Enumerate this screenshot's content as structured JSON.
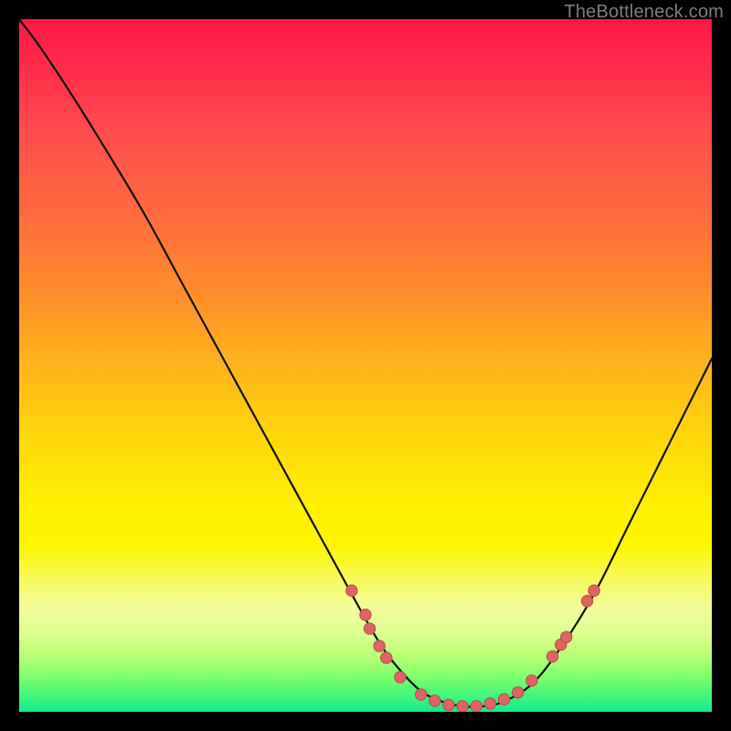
{
  "watermark": "TheBottleneck.com",
  "colors": {
    "background": "#000000",
    "curve_stroke": "#111111",
    "dot_fill": "#e06464",
    "dot_stroke": "#b94a4a",
    "watermark": "#7d7d7d"
  },
  "chart_data": {
    "type": "line",
    "title": "",
    "xlabel": "",
    "ylabel": "",
    "xlim": [
      0,
      100
    ],
    "ylim": [
      0,
      100
    ],
    "grid": false,
    "series": [
      {
        "name": "bottleneck-curve",
        "x": [
          0,
          3,
          7,
          12,
          18,
          24,
          30,
          36,
          42,
          48,
          52,
          55,
          58,
          61,
          64,
          67,
          70,
          74,
          78,
          83,
          88,
          93,
          98,
          100
        ],
        "y": [
          100,
          96,
          90,
          82,
          72,
          61,
          50,
          39,
          28,
          17,
          10,
          6,
          3,
          1.5,
          0.8,
          0.8,
          1.5,
          4,
          9,
          17,
          27,
          37,
          47,
          51
        ]
      }
    ],
    "points": [
      {
        "name": "p1",
        "x": 48.0,
        "y": 17.5
      },
      {
        "name": "p2",
        "x": 50.0,
        "y": 14.0
      },
      {
        "name": "p3",
        "x": 50.6,
        "y": 12.0
      },
      {
        "name": "p4",
        "x": 52.0,
        "y": 9.5
      },
      {
        "name": "p5",
        "x": 53.0,
        "y": 7.8
      },
      {
        "name": "p6",
        "x": 55.0,
        "y": 5.0
      },
      {
        "name": "p7",
        "x": 58.0,
        "y": 2.5
      },
      {
        "name": "p8",
        "x": 60.0,
        "y": 1.6
      },
      {
        "name": "p9",
        "x": 62.0,
        "y": 1.0
      },
      {
        "name": "p10",
        "x": 64.0,
        "y": 0.8
      },
      {
        "name": "p11",
        "x": 66.0,
        "y": 0.8
      },
      {
        "name": "p12",
        "x": 68.0,
        "y": 1.2
      },
      {
        "name": "p13",
        "x": 70.0,
        "y": 1.8
      },
      {
        "name": "p14",
        "x": 72.0,
        "y": 2.8
      },
      {
        "name": "p15",
        "x": 74.0,
        "y": 4.5
      },
      {
        "name": "p16",
        "x": 77.0,
        "y": 8.0
      },
      {
        "name": "p17",
        "x": 78.2,
        "y": 9.7
      },
      {
        "name": "p18",
        "x": 79.0,
        "y": 10.8
      },
      {
        "name": "p19",
        "x": 82.0,
        "y": 16.0
      },
      {
        "name": "p20",
        "x": 83.0,
        "y": 17.5
      }
    ],
    "annotations": []
  }
}
